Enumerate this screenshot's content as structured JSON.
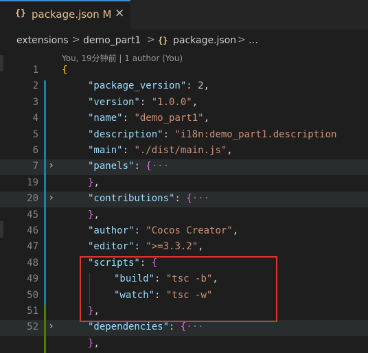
{
  "tab": {
    "icon": "{}",
    "label": "package.json M",
    "close": "×",
    "accent": "#3e8ed0"
  },
  "breadcrumb": {
    "items": [
      "extensions",
      "demo_part1",
      "package.json",
      "…"
    ],
    "separator": ">",
    "file_icon": "{}"
  },
  "codelens": "You, 19分钟前 | 1 author (You)",
  "lines": [
    {
      "n": "1",
      "parts": [
        {
          "t": "{",
          "c": "brace-y"
        }
      ]
    },
    {
      "n": "2",
      "parts": [
        {
          "t": "\"package_version\"",
          "c": "key"
        },
        {
          "t": ": "
        },
        {
          "t": "2",
          "c": "num"
        },
        {
          "t": ","
        }
      ]
    },
    {
      "n": "3",
      "parts": [
        {
          "t": "\"version\"",
          "c": "key"
        },
        {
          "t": ": "
        },
        {
          "t": "\"1.0.0\"",
          "c": "str"
        },
        {
          "t": ","
        }
      ]
    },
    {
      "n": "4",
      "parts": [
        {
          "t": "\"name\"",
          "c": "key"
        },
        {
          "t": ": "
        },
        {
          "t": "\"demo_part1\"",
          "c": "str"
        },
        {
          "t": ","
        }
      ]
    },
    {
      "n": "5",
      "parts": [
        {
          "t": "\"description\"",
          "c": "key"
        },
        {
          "t": ": "
        },
        {
          "t": "\"i18n:demo_part1.description",
          "c": "str"
        }
      ]
    },
    {
      "n": "6",
      "parts": [
        {
          "t": "\"main\"",
          "c": "key"
        },
        {
          "t": ": "
        },
        {
          "t": "\"./dist/main.js\"",
          "c": "str"
        },
        {
          "t": ","
        }
      ]
    },
    {
      "n": "7",
      "parts": [
        {
          "t": "\"panels\"",
          "c": "key"
        },
        {
          "t": ": "
        },
        {
          "t": "{",
          "c": "brace-p"
        },
        {
          "t": "···",
          "c": "ellipsis"
        }
      ]
    },
    {
      "n": "19",
      "parts": [
        {
          "t": "}",
          "c": "brace-p"
        },
        {
          "t": ","
        }
      ]
    },
    {
      "n": "20",
      "parts": [
        {
          "t": "\"contributions\"",
          "c": "key"
        },
        {
          "t": ": "
        },
        {
          "t": "{",
          "c": "brace-p"
        },
        {
          "t": "···",
          "c": "ellipsis"
        }
      ]
    },
    {
      "n": "45",
      "parts": [
        {
          "t": "}",
          "c": "brace-p"
        },
        {
          "t": ","
        }
      ]
    },
    {
      "n": "46",
      "parts": [
        {
          "t": "\"author\"",
          "c": "key"
        },
        {
          "t": ": "
        },
        {
          "t": "\"Cocos Creator\"",
          "c": "str"
        },
        {
          "t": ","
        }
      ]
    },
    {
      "n": "47",
      "parts": [
        {
          "t": "\"editor\"",
          "c": "key"
        },
        {
          "t": ": "
        },
        {
          "t": "\">=3.3.2\"",
          "c": "str"
        },
        {
          "t": ","
        }
      ]
    },
    {
      "n": "48",
      "parts": [
        {
          "t": "\"scripts\"",
          "c": "key"
        },
        {
          "t": ": "
        },
        {
          "t": "{",
          "c": "brace-p"
        }
      ]
    },
    {
      "n": "49",
      "parts": [
        {
          "t": "\"build\"",
          "c": "key"
        },
        {
          "t": ": "
        },
        {
          "t": "\"tsc -b\"",
          "c": "str"
        },
        {
          "t": ","
        }
      ]
    },
    {
      "n": "50",
      "parts": [
        {
          "t": "\"watch\"",
          "c": "key"
        },
        {
          "t": ": "
        },
        {
          "t": "\"tsc -w\"",
          "c": "str"
        }
      ]
    },
    {
      "n": "51",
      "parts": [
        {
          "t": "}",
          "c": "brace-p"
        },
        {
          "t": ","
        }
      ]
    },
    {
      "n": "52",
      "parts": [
        {
          "t": "\"dependencies\"",
          "c": "key"
        },
        {
          "t": ": "
        },
        {
          "t": "{",
          "c": "brace-p"
        },
        {
          "t": "···",
          "c": "ellipsis"
        }
      ]
    },
    {
      "n": "",
      "parts": [
        {
          "t": "}",
          "c": "brace-p"
        },
        {
          "t": ","
        }
      ]
    }
  ]
}
